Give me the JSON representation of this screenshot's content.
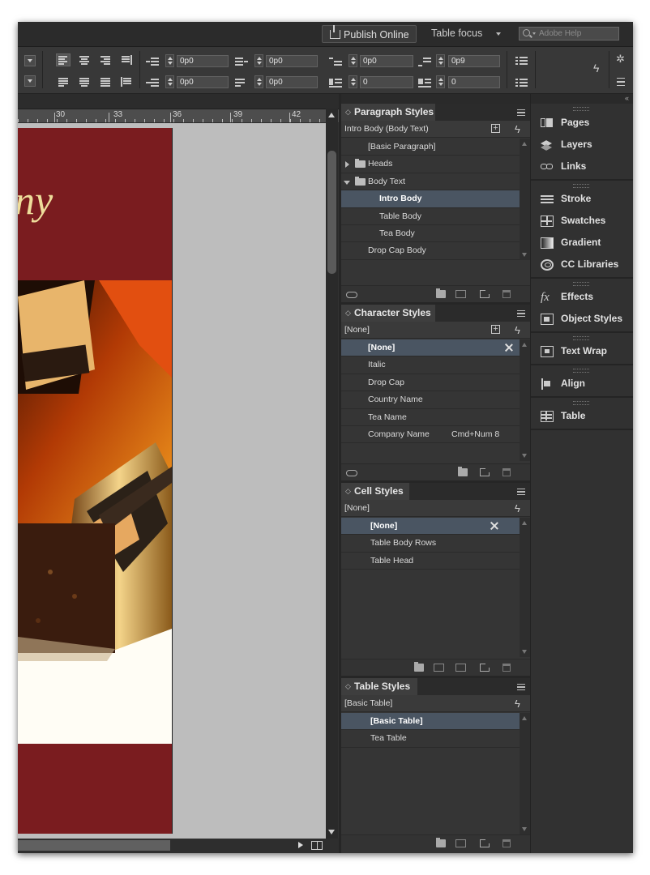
{
  "topbar": {
    "publish_label": "Publish Online",
    "workspace": "Table focus",
    "help_placeholder": "Adobe Help"
  },
  "control_bar": {
    "fields": [
      "0p0",
      "0p0",
      "0p0",
      "0p9",
      "0p0",
      "0p0",
      "0",
      "0"
    ]
  },
  "ruler": {
    "marks": [
      "30",
      "33",
      "36",
      "39",
      "42"
    ]
  },
  "document": {
    "heading_fragment": "ny"
  },
  "paragraph_styles": {
    "tab": "Paragraph Styles",
    "current": "Intro Body (Body Text)",
    "items": [
      {
        "label": "[Basic Paragraph]"
      },
      {
        "label": "Heads"
      },
      {
        "label": "Body Text"
      },
      {
        "label": "Intro Body"
      },
      {
        "label": "Table Body"
      },
      {
        "label": "Tea Body"
      },
      {
        "label": "Drop Cap Body"
      }
    ]
  },
  "character_styles": {
    "tab": "Character Styles",
    "current": "[None]",
    "items": [
      {
        "label": "[None]"
      },
      {
        "label": "Italic"
      },
      {
        "label": "Drop Cap"
      },
      {
        "label": "Country Name"
      },
      {
        "label": "Tea Name"
      },
      {
        "label": "Company Name",
        "shortcut": "Cmd+Num 8"
      }
    ]
  },
  "cell_styles": {
    "tab": "Cell Styles",
    "current": "[None]",
    "items": [
      {
        "label": "[None]"
      },
      {
        "label": "Table Body Rows"
      },
      {
        "label": "Table Head"
      }
    ]
  },
  "table_styles": {
    "tab": "Table Styles",
    "current": "[Basic Table]",
    "items": [
      {
        "label": "[Basic Table]"
      },
      {
        "label": "Tea Table"
      }
    ]
  },
  "side_panels": [
    {
      "label": "Pages",
      "icon": "pages-icon"
    },
    {
      "label": "Layers",
      "icon": "layers-icon"
    },
    {
      "label": "Links",
      "icon": "links-icon"
    },
    {
      "label": "Stroke",
      "icon": "stroke-icon"
    },
    {
      "label": "Swatches",
      "icon": "swatches-icon"
    },
    {
      "label": "Gradient",
      "icon": "gradient-icon"
    },
    {
      "label": "CC Libraries",
      "icon": "cc-libraries-icon"
    },
    {
      "label": "Effects",
      "icon": "effects-icon"
    },
    {
      "label": "Object Styles",
      "icon": "object-styles-icon"
    },
    {
      "label": "Text Wrap",
      "icon": "text-wrap-icon"
    },
    {
      "label": "Align",
      "icon": "align-icon"
    },
    {
      "label": "Table",
      "icon": "table-icon"
    }
  ],
  "colors": {
    "page_background": "#7a1c1f",
    "selection": "#4a5562",
    "script_text": "#eedd9b"
  }
}
